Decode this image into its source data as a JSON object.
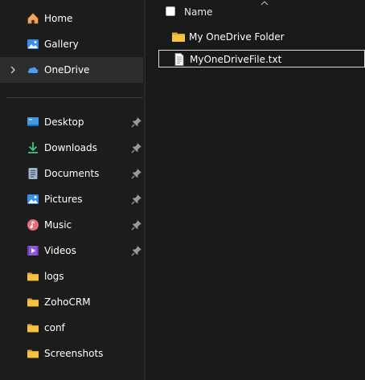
{
  "nav": {
    "home": "Home",
    "gallery": "Gallery",
    "onedrive": "OneDrive",
    "quick_access": [
      {
        "label": "Desktop",
        "icon": "desktop-icon",
        "pinned": true
      },
      {
        "label": "Downloads",
        "icon": "downloads-icon",
        "pinned": true
      },
      {
        "label": "Documents",
        "icon": "documents-icon",
        "pinned": true
      },
      {
        "label": "Pictures",
        "icon": "pictures-icon",
        "pinned": true
      },
      {
        "label": "Music",
        "icon": "music-icon",
        "pinned": true
      },
      {
        "label": "Videos",
        "icon": "videos-icon",
        "pinned": true
      },
      {
        "label": "logs",
        "icon": "folder-icon",
        "pinned": false
      },
      {
        "label": "ZohoCRM",
        "icon": "folder-icon",
        "pinned": false
      },
      {
        "label": "conf",
        "icon": "folder-icon",
        "pinned": false
      },
      {
        "label": "Screenshots",
        "icon": "folder-icon",
        "pinned": false
      }
    ]
  },
  "content": {
    "column_header": "Name",
    "items": [
      {
        "label": "My OneDrive Folder",
        "icon": "folder-icon"
      },
      {
        "label": "MyOneDriveFile.txt",
        "icon": "text-file-icon"
      }
    ]
  },
  "colors": {
    "background": "#191919",
    "nav_background": "#1c1c1c",
    "selected": "#2d2d2d",
    "folder": "#f5c342",
    "onedrive": "#4a9ff5",
    "downloads": "#3cc77f"
  }
}
